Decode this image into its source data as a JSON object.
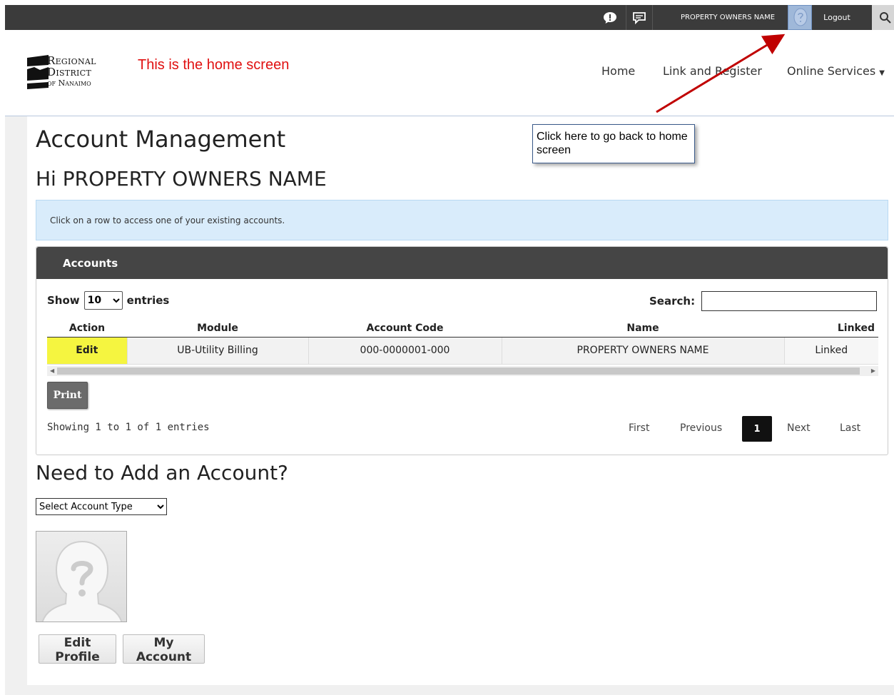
{
  "topbar": {
    "user_name": "PROPERTY OWNERS NAME",
    "logout": "Logout",
    "icons": [
      "alert-icon",
      "chat-icon",
      "avatar",
      "search-icon"
    ]
  },
  "header": {
    "logo": {
      "line1": "Regional",
      "line2": "District",
      "line3": "of Nanaimo"
    },
    "annotation": "This is the home screen",
    "nav": {
      "home": "Home",
      "link_register": "Link and Register",
      "online_services": "Online Services"
    }
  },
  "callout": {
    "text": "Click here to go back to home screen"
  },
  "page": {
    "title": "Account Management",
    "greeting": "Hi PROPERTY OWNERS NAME",
    "info": "Click on a row to access one of your existing accounts."
  },
  "accounts": {
    "panel_title": "Accounts",
    "show_label": "Show",
    "entries_label": "entries",
    "show_value": "10",
    "search_label": "Search:",
    "columns": [
      "Action",
      "Module",
      "Account Code",
      "Name",
      "Linked"
    ],
    "rows": [
      {
        "action": "Edit",
        "module": "UB-Utility Billing",
        "account_code": "000-0000001-000",
        "name": "PROPERTY OWNERS NAME",
        "linked": "Linked"
      }
    ],
    "print": "Print",
    "showing": "Showing 1 to 1 of 1 entries",
    "pager": {
      "first": "First",
      "previous": "Previous",
      "current": "1",
      "next": "Next",
      "last": "Last"
    }
  },
  "add": {
    "title": "Need to Add an Account?",
    "select_placeholder": "Select Account Type"
  },
  "profile": {
    "edit_profile": "Edit Profile",
    "my_account": "My Account"
  },
  "colors": {
    "topbar": "#3b3b3b",
    "info_bg": "#d9ecfb",
    "edit_highlight": "#f5f540",
    "annotation_red": "#e01010",
    "arrow": "#c00000"
  }
}
